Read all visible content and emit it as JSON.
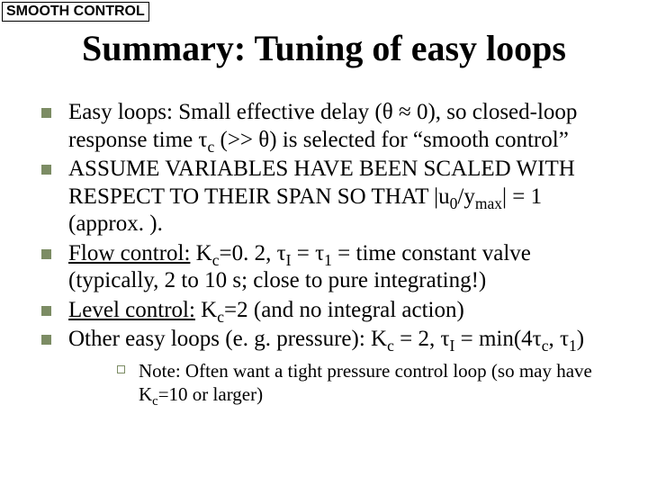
{
  "tag": "SMOOTH CONTROL",
  "title": "Summary: Tuning of easy loops",
  "sym": {
    "theta": "θ",
    "tau": "τ",
    "approx": " ≈ ",
    "c": "c",
    "I": "I",
    "one": "1"
  },
  "bullets": [
    {
      "pre": "Easy loops: Small effective delay (",
      "mid1": "0), so closed-loop response time ",
      "mid2": " (>> ",
      "post": ") is selected for “smooth control”"
    },
    {
      "pre": "ASSUME VARIABLES HAVE BEEN SCALED WITH RESPECT TO THEIR SPAN SO THAT |u",
      "sub1": "0",
      "mid": "/y",
      "sub2": "max",
      "post": "| = 1 (approx. )."
    },
    {
      "lead": "Flow control:",
      "t1": " K",
      "t2": "=0. 2, ",
      "t3": " = ",
      "t4": " = time constant valve (typically, 2 to 10 s; close to pure integrating!)"
    },
    {
      "lead": "Level control:",
      "t1": " K",
      "t2": "=2 (and no integral action)"
    },
    {
      "t1": "Other easy loops (e. g. pressure): K",
      "t2": " = 2, ",
      "t3": " = min(4",
      "t4": ", ",
      "t5": ")",
      "note": {
        "t1": "Note: Often want a tight pressure control loop (so may have K",
        "t2": "=10 or larger)"
      }
    }
  ]
}
